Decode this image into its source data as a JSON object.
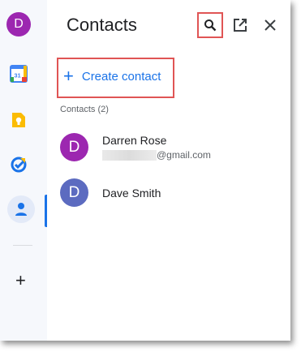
{
  "rail": {
    "account_initial": "D",
    "calendar_badge": "31",
    "icons": [
      "calendar-icon",
      "keep-icon",
      "tasks-icon",
      "contacts-icon",
      "add-icon"
    ]
  },
  "panel": {
    "title": "Contacts",
    "create_label": "Create contact",
    "section_label": "Contacts (2)"
  },
  "contacts": [
    {
      "initial": "D",
      "name": "Darren Rose",
      "email_visible": "@gmail.com",
      "color": "#9c27b0"
    },
    {
      "initial": "D",
      "name": "Dave Smith",
      "color": "#5c6bc0"
    }
  ],
  "colors": {
    "accent": "#1a73e8",
    "highlight": "#e05555"
  }
}
